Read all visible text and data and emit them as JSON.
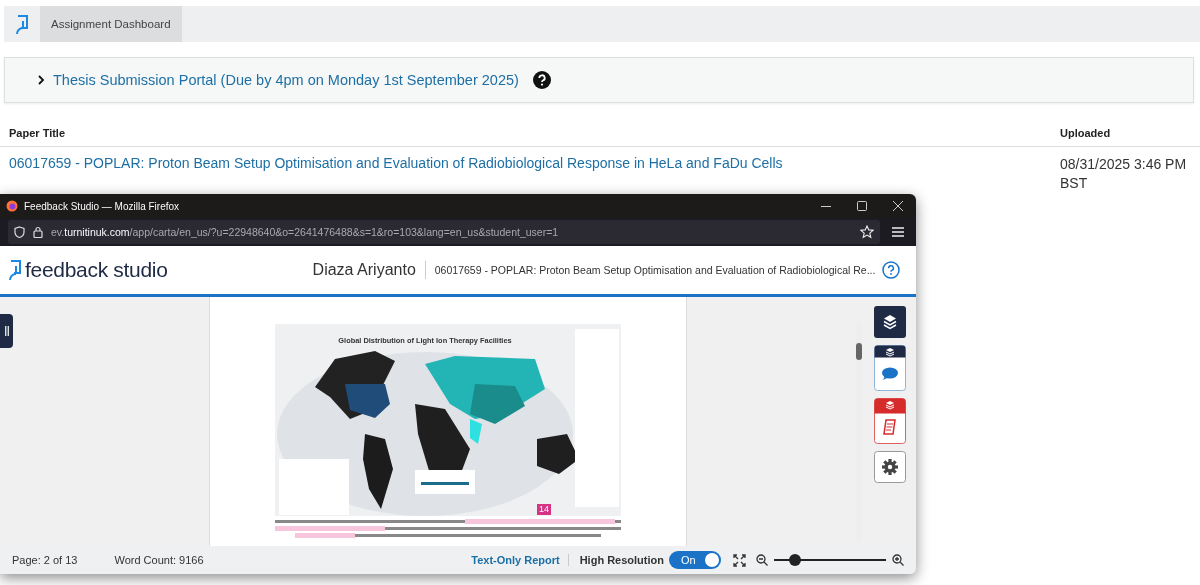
{
  "top_nav": {
    "tabs": [
      {
        "label": "Assignment Dashboard",
        "selected": true
      }
    ]
  },
  "assignment": {
    "title": "Thesis Submission Portal (Due by 4pm on Monday 1st September 2025)",
    "expanded": false
  },
  "table": {
    "columns": [
      "Paper Title",
      "Uploaded"
    ],
    "rows": [
      {
        "paper_title": "06017659 - POPLAR: Proton Beam Setup Optimisation and Evaluation of Radiobiological Response in HeLa and FaDu Cells",
        "uploaded": "08/31/2025 3:46 PM BST"
      }
    ]
  },
  "browser": {
    "title": "Feedback Studio — Mozilla Firefox",
    "url": "ev.**turnitinuk.com**/app/carta/en_us/?u=22948640&o=2641476488&s=1&ro=103&lang=en_us&student_user=1"
  },
  "app": {
    "logo": "feedback studio",
    "student": "Diaza Ariyanto",
    "paper": "06017659 - POPLAR: Proton Beam Setup Optimisation and Evaluation of Radiobiological Re..."
  },
  "document": {
    "figure_title": "Global Distribution of Light Ion Therapy Facilities",
    "match_marker": "14"
  },
  "side_tools": [
    {
      "kind": "layers"
    },
    {
      "kind": "comments"
    },
    {
      "kind": "similarity"
    },
    {
      "kind": "settings"
    }
  ],
  "status_bar": {
    "page": "Page: 2 of 13",
    "word_count": "Word Count: 9166",
    "text_only_link": "Text-Only Report",
    "high_res_label": "High Resolution",
    "toggle": {
      "label": "On",
      "on": true
    },
    "zoom": {
      "level": 0.15
    }
  }
}
